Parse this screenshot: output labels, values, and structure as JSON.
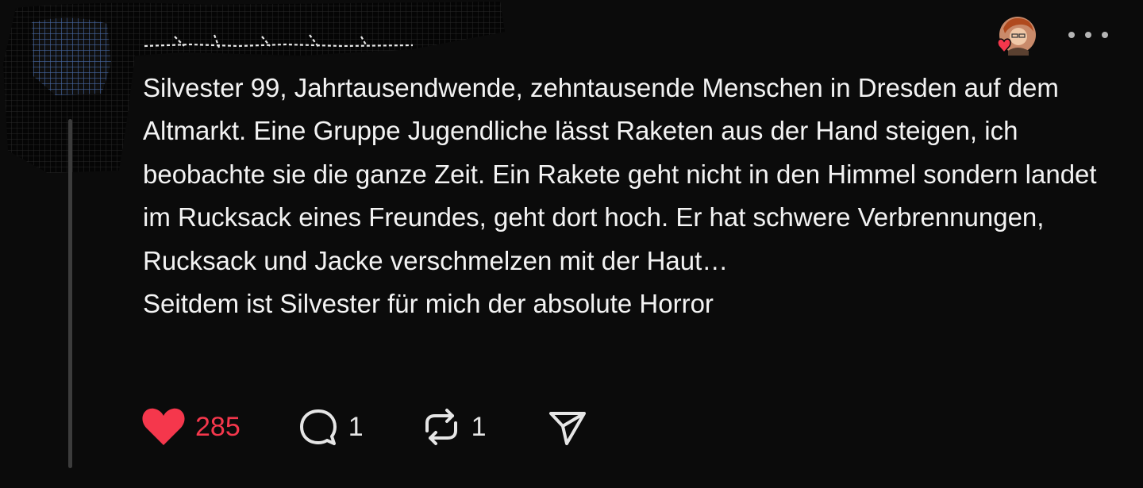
{
  "post": {
    "author_name": "",
    "text": "Silvester 99, Jahrtausendwende, zehntausende Menschen in Dresden auf dem Altmarkt. Eine Gruppe Jugendliche lässt Raketen aus der Hand steigen, ich beobachte sie die ganze Zeit. Ein Rakete geht nicht in den Himmel sondern landet im Rucksack eines Freundes, geht dort hoch. Er hat schwere Verbrennungen, Rucksack und Jacke verschmelzen mit der Haut…\nSeitdem ist Silvester für mich der absolute Horror",
    "liked_by_author_icon": "heart-badge-icon"
  },
  "actions": {
    "like": {
      "icon": "heart-icon",
      "count": "285",
      "color": "#f5374c",
      "active": true
    },
    "comment": {
      "icon": "comment-icon",
      "count": "1"
    },
    "repost": {
      "icon": "repost-icon",
      "count": "1"
    },
    "share": {
      "icon": "share-icon"
    }
  },
  "more": {
    "icon": "more-icon"
  },
  "colors": {
    "background": "#0b0b0b",
    "text": "#f3f3f3",
    "accent": "#f5374c",
    "thread_line": "#3c3c3c"
  }
}
